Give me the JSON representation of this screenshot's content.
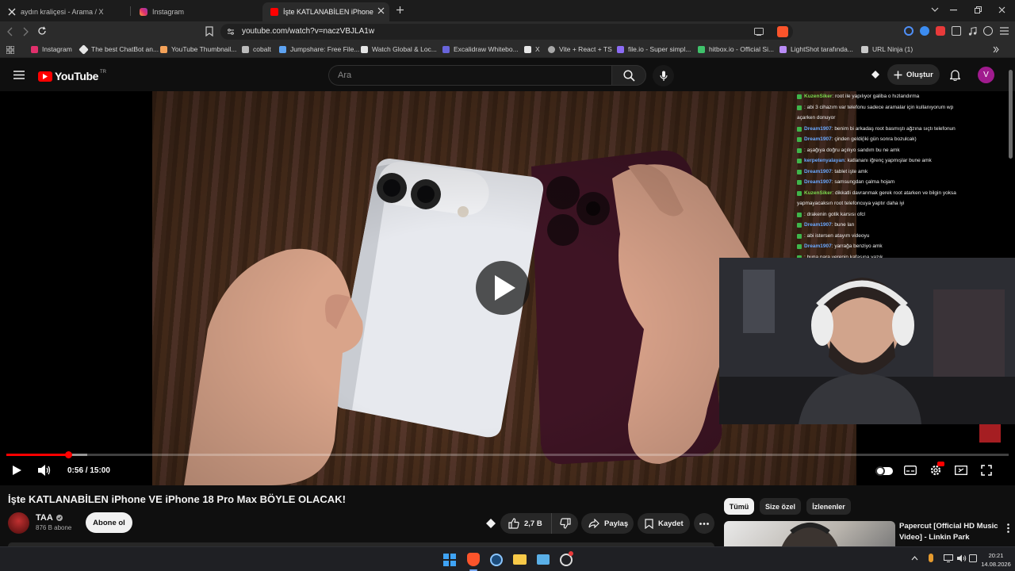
{
  "browser": {
    "tabs": [
      {
        "label": "aydın kraliçesi - Arama / X",
        "icon": "x-logo-icon"
      },
      {
        "label": "Instagram",
        "icon": "instagram-icon"
      },
      {
        "label": "İşte KATLANABİLEN iPhone VE iP",
        "icon": "youtube-icon",
        "active": true
      }
    ],
    "url": "youtube.com/watch?v=naczVBJLA1w",
    "bookmarks": [
      {
        "label": "Instagram",
        "color": "#e1306c"
      },
      {
        "label": "The best ChatBot an...",
        "color": "#e6e6e6"
      },
      {
        "label": "YouTube Thumbnail...",
        "color": "#f4a259"
      },
      {
        "label": "cobalt",
        "color": "#bbbbbb"
      },
      {
        "label": "Jumpshare: Free File...",
        "color": "#5ea3f2"
      },
      {
        "label": "Watch Global & Loc...",
        "color": "#e6e6e6"
      },
      {
        "label": "Excalidraw Whitebo...",
        "color": "#6965db"
      },
      {
        "label": "X",
        "color": "#e6e6e6"
      },
      {
        "label": "Vite + React + TS",
        "color": "#a8a8a8"
      },
      {
        "label": "file.io - Super simpl...",
        "color": "#8c6cf5"
      },
      {
        "label": "hitbox.io - Official Si...",
        "color": "#3fc26b"
      },
      {
        "label": "LightShot tarafında...",
        "color": "#b98cf7"
      },
      {
        "label": "URL Ninja (1)",
        "color": "#c9c9c9"
      }
    ]
  },
  "youtube": {
    "logo_text": "YouTube",
    "region": "TR",
    "search_placeholder": "Ara",
    "create_label": "Oluştur",
    "avatar_letter": "V"
  },
  "chat": [
    {
      "user": "KuzenSiker",
      "color": "#7ddc4f",
      "text": ": root ile yapılıyor galiba o hızlandırma"
    },
    {
      "user": "",
      "color": "#e74c3c",
      "text": ": abi 3 cihazım var telefonu sadece aramalar için kullanıyorum wp"
    },
    {
      "user": "",
      "color": "#ffffff",
      "text": "açarken donuyor",
      "cont": true
    },
    {
      "user": "Dream1907",
      "color": "#6aa8ff",
      "text": ": benim bi arkadaş root basmıştı ağzına sıçtı telefonun"
    },
    {
      "user": "Dream1907",
      "color": "#6aa8ff",
      "text": ": çinden geldi(iki gün sonra bozulcak)"
    },
    {
      "user": "",
      "color": "#e55aa6",
      "text": ": aşağıya doğru açılıyo sandım bu ne amk"
    },
    {
      "user": "kerpetenyalayan",
      "color": "#6aa8ff",
      "text": ": katlananı iğrenç yapmışlar bune amk"
    },
    {
      "user": "Dream1907",
      "color": "#6aa8ff",
      "text": ": tablet işte amk"
    },
    {
      "user": "Dream1907",
      "color": "#6aa8ff",
      "text": ": samsungdan çalma hojam"
    },
    {
      "user": "KuzenSiker",
      "color": "#7ddc4f",
      "text": ": dikkatli davranmak gerek root atarken ve bilgin yoksa"
    },
    {
      "user": "",
      "color": "#ffffff",
      "text": "yapmayacaksın root telefoncuya yaptır daha iyi",
      "cont": true
    },
    {
      "user": "",
      "color": "#e74c3c",
      "text": ": drakenin gotik karsısı ofcl"
    },
    {
      "user": "Dream1907",
      "color": "#6aa8ff",
      "text": ": bune lan"
    },
    {
      "user": "",
      "color": "#e74c3c",
      "text": ": abi istersen atayım videoyu"
    },
    {
      "user": "Dream1907",
      "color": "#6aa8ff",
      "text": ": yarrağa benziyo amk"
    },
    {
      "user": "",
      "color": "#e55aa6",
      "text": ": buna para verenin kafasına yazık"
    }
  ],
  "player": {
    "time": "0:56 / 15:00",
    "progress_played": 0.062,
    "progress_buffered": 0.081
  },
  "video": {
    "title": "İşte KATLANABİLEN iPhone VE iPhone 18 Pro Max BÖYLE OLACAK!",
    "channel": "TAA",
    "subscribers": "876 B abone",
    "subscribe_label": "Abone ol",
    "likes": "2,7 B",
    "share_label": "Paylaş",
    "save_label": "Kaydet"
  },
  "sidebar": {
    "chips": [
      "Tümü",
      "Size özel",
      "İzlenenler"
    ],
    "first_video_title": "Papercut [Official HD Music Video] - Linkin Park"
  },
  "taskbar": {
    "time": "20:21",
    "date": "14.08.2026"
  }
}
